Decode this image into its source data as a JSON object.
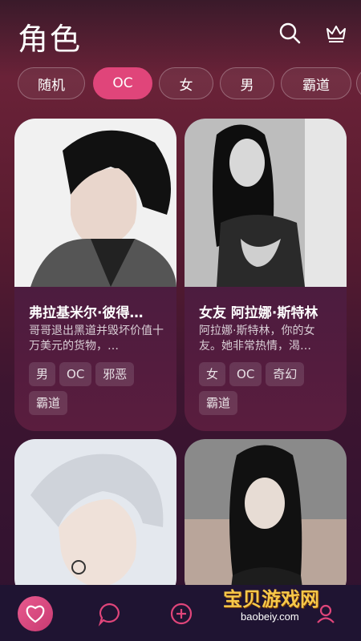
{
  "header": {
    "title": "角色"
  },
  "filters": [
    "随机",
    "OC",
    "女",
    "男",
    "霸道"
  ],
  "active_filter": "OC",
  "cards": [
    {
      "title": "弗拉基米尔·彼得…",
      "desc": "哥哥退出黑道并毁坏价值十万美元的货物，…",
      "tags": [
        "男",
        "OC",
        "邪恶",
        "霸道"
      ]
    },
    {
      "title": "女友 阿拉娜·斯特林",
      "desc": "阿拉娜·斯特林，你的女友。她非常热情，渴…",
      "tags": [
        "女",
        "OC",
        "奇幻",
        "霸道"
      ]
    },
    {
      "title": "",
      "desc": "",
      "tags": []
    },
    {
      "title": "",
      "desc": "",
      "tags": []
    }
  ],
  "watermark": {
    "text": "宝贝游戏网",
    "url": "baobeiy.com"
  },
  "colors": {
    "accent": "#e0457a",
    "bar": "#1f1432"
  }
}
